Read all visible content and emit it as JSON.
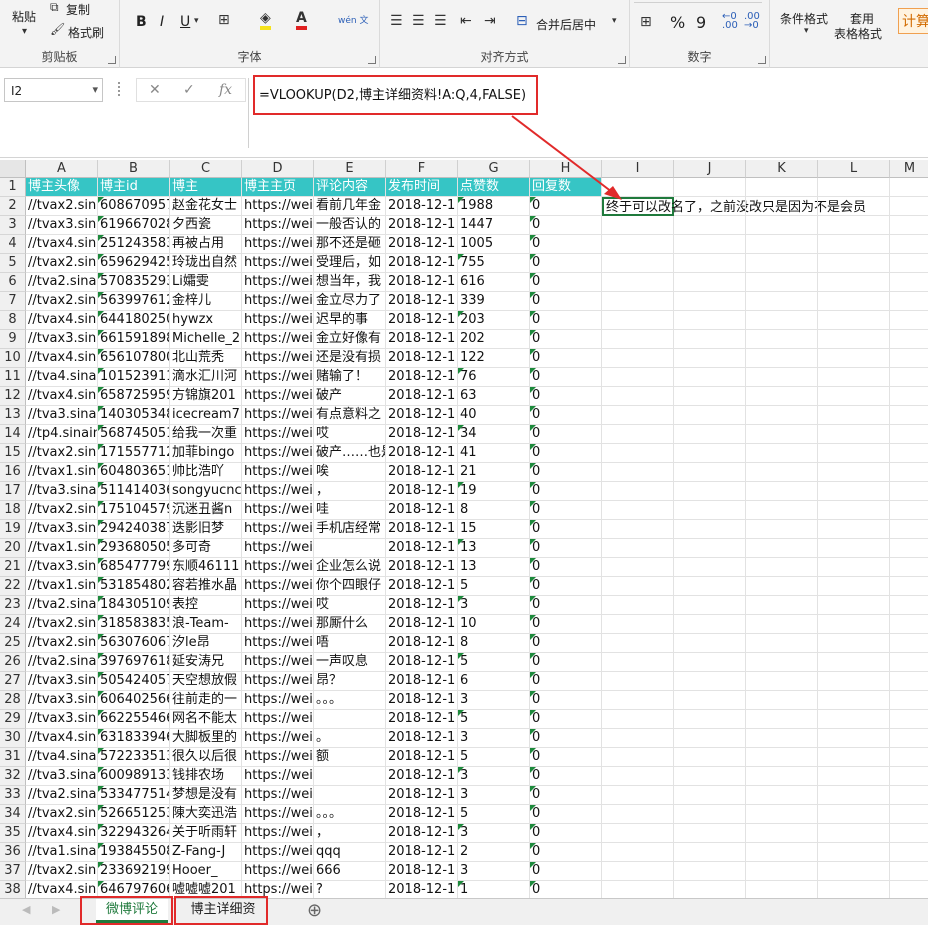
{
  "ribbon": {
    "clipboard": {
      "paste": "粘贴",
      "copy": "复制",
      "format_painter": "格式刷",
      "label": "剪贴板"
    },
    "font": {
      "bold": "B",
      "italic": "I",
      "underline": "U",
      "label": "字体",
      "wen": "wén 文"
    },
    "alignment": {
      "merge": "合并后居中",
      "label": "对齐方式"
    },
    "number": {
      "percent": "%",
      "comma": "9",
      "label": "数字"
    },
    "styles": {
      "conditional": "条件格式",
      "table_format_1": "套用",
      "table_format_2": "表格格式",
      "calc": "计算"
    }
  },
  "formula_bar": {
    "name_box": "I2",
    "cancel": "✕",
    "enter": "✓",
    "fx": "fx",
    "formula": "=VLOOKUP(D2,博主详细资料!A:Q,4,FALSE)"
  },
  "columns": [
    "A",
    "B",
    "C",
    "D",
    "E",
    "F",
    "G",
    "H",
    "I",
    "J",
    "K",
    "L",
    "M"
  ],
  "header_row": [
    "博主头像",
    "博主id",
    "博主",
    "博主主页",
    "评论内容",
    "发布时间",
    "点赞数",
    "回复数"
  ],
  "i2_value": "终于可以改名了，之前没改只是因为不是会员",
  "rows": [
    [
      "//tvax2.sina",
      "608670957",
      "赵金花女士",
      "https://wei",
      "看前几年金",
      "2018-12-1",
      "1988",
      "0"
    ],
    [
      "//tvax3.sina",
      "619667028",
      "夕西瓷",
      "https://wei",
      "一般否认的",
      "2018-12-1",
      "1447",
      "0"
    ],
    [
      "//tvax4.sina",
      "251243583",
      "再被占用",
      "https://wei",
      "那不还是砸",
      "2018-12-1",
      "1005",
      "0"
    ],
    [
      "//tvax2.sina",
      "659629425",
      "玲珑出自然",
      "https://wei",
      "受理后，如",
      "2018-12-1",
      "755",
      "0"
    ],
    [
      "//tva2.sina",
      "570835293",
      "Li孀雯",
      "https://wei",
      "想当年，我",
      "2018-12-1",
      "616",
      "0"
    ],
    [
      "//tvax2.sina",
      "563997612",
      "金梓儿",
      "https://wei",
      "金立尽力了",
      "2018-12-1",
      "339",
      "0"
    ],
    [
      "//tvax4.sina",
      "644180250",
      "hywzx",
      "https://wei",
      "迟早的事",
      "2018-12-1",
      "203",
      "0"
    ],
    [
      "//tvax3.sina",
      "661591898",
      "Michelle_2",
      "https://wei",
      "金立好像有",
      "2018-12-1",
      "202",
      "0"
    ],
    [
      "//tvax4.sina",
      "656107800",
      "北山荒秃",
      "https://wei",
      "还是没有损",
      "2018-12-1",
      "122",
      "0"
    ],
    [
      "//tva4.sina",
      "101523911",
      "滴水汇川河",
      "https://wei",
      "赌输了！",
      "2018-12-1",
      "76",
      "0"
    ],
    [
      "//tvax4.sina",
      "658725959",
      "方锦旗201",
      "https://wei",
      "破产",
      "2018-12-1",
      "63",
      "0"
    ],
    [
      "//tva3.sina",
      "140305348",
      "icecream7",
      "https://wei",
      "有点意料之",
      "2018-12-1",
      "40",
      "0"
    ],
    [
      "//tp4.sinaim",
      "568745051",
      "给我一次重",
      "https://wei",
      "哎",
      "2018-12-1",
      "34",
      "0"
    ],
    [
      "//tvax2.sina",
      "171557712",
      "加菲bingo",
      "https://wei",
      "破产……也是",
      "2018-12-1",
      "41",
      "0"
    ],
    [
      "//tvax1.sina",
      "604803651",
      "帅比浩吖",
      "https://wei",
      "唉",
      "2018-12-1",
      "21",
      "0"
    ],
    [
      "//tva3.sina",
      "511414036",
      "songyucnc",
      "https://wei",
      "，",
      "2018-12-1",
      "19",
      "0"
    ],
    [
      "//tvax2.sina",
      "175104579",
      "沉迷丑酱n",
      "https://wei",
      "哇",
      "2018-12-1",
      "8",
      "0"
    ],
    [
      "//tvax3.sina",
      "294240387",
      "迭影旧梦",
      "https://wei",
      "手机店经常",
      "2018-12-1",
      "15",
      "0"
    ],
    [
      "//tvax1.sina",
      "293680505",
      "多可奇",
      "https://wei",
      "",
      "2018-12-1",
      "13",
      "0"
    ],
    [
      "//tvax3.sina",
      "685477799",
      "东顺46111",
      "https://wei",
      "企业怎么说",
      "2018-12-1",
      "13",
      "0"
    ],
    [
      "//tvax1.sina",
      "531854802",
      "容若推水晶",
      "https://wei",
      "你个四眼仔",
      "2018-12-1",
      "5",
      "0"
    ],
    [
      "//tva2.sina",
      "184305109",
      "表控",
      "https://wei",
      "哎",
      "2018-12-1",
      "3",
      "0"
    ],
    [
      "//tvax2.sina",
      "318583835",
      "浪-Team-",
      "https://wei",
      "那厮什么",
      "2018-12-1",
      "10",
      "0"
    ],
    [
      "//tvax2.sina",
      "563076067",
      "汐le昂",
      "https://wei",
      "唔",
      "2018-12-1",
      "8",
      "0"
    ],
    [
      "//tva2.sina",
      "397697618",
      "延安涛兄",
      "https://wei",
      "一声叹息",
      "2018-12-1",
      "5",
      "0"
    ],
    [
      "//tvax3.sina",
      "505424057",
      "天空想放假",
      "https://wei",
      "昂？",
      "2018-12-1",
      "6",
      "0"
    ],
    [
      "//tvax3.sina",
      "606402566",
      "往前走的一",
      "https://wei",
      "。。。",
      "2018-12-1",
      "3",
      "0"
    ],
    [
      "//tvax3.sina",
      "662255466",
      "网名不能太",
      "https://wei",
      "",
      "2018-12-1",
      "5",
      "0"
    ],
    [
      "//tvax4.sina",
      "631833946",
      "大脚板里的",
      "https://wei",
      "。",
      "2018-12-1",
      "3",
      "0"
    ],
    [
      "//tva4.sina",
      "572233513",
      "很久以后很",
      "https://wei",
      "额",
      "2018-12-1",
      "5",
      "0"
    ],
    [
      "//tva3.sina",
      "600989133",
      "钱排农场",
      "https://wei",
      "",
      "2018-12-1",
      "3",
      "0"
    ],
    [
      "//tva2.sina",
      "533477514",
      "梦想是没有",
      "https://wei",
      "",
      "2018-12-1",
      "3",
      "0"
    ],
    [
      "//tvax2.sina",
      "526651253",
      "陳大奕迅浩",
      "https://wei",
      "。。。",
      "2018-12-1",
      "5",
      "0"
    ],
    [
      "//tvax4.sina",
      "322943264",
      "关于听雨轩",
      "https://wei",
      "，",
      "2018-12-1",
      "3",
      "0"
    ],
    [
      "//tva1.sina",
      "193845508",
      "Z-Fang-J",
      "https://wei",
      "qqq",
      "2018-12-1",
      "2",
      "0"
    ],
    [
      "//tvax2.sina",
      "233692199",
      "Hooer_",
      "https://wei",
      "666",
      "2018-12-1",
      "3",
      "0"
    ],
    [
      "//tvax4.sina",
      "646797606",
      "嘘嘘嘘201",
      "https://wei",
      "?",
      "2018-12-1",
      "1",
      "0"
    ]
  ],
  "sheets": {
    "active": "微博评论",
    "second": "博主详细资料",
    "add": "⊕"
  },
  "colors": {
    "header_fill": "#36c5c5",
    "highlight": "#e12a2a",
    "active_tab": "#1f7a3c"
  }
}
